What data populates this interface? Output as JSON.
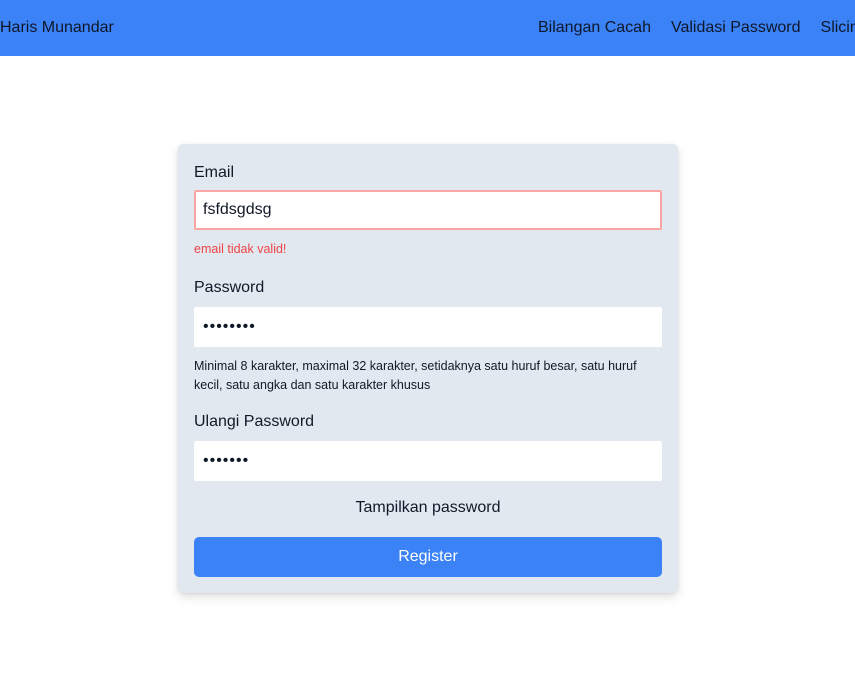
{
  "navbar": {
    "brand": "Haris Munandar",
    "links": [
      "Bilangan Cacah",
      "Validasi Password",
      "Slicing"
    ],
    "background": "#3b82f6"
  },
  "form": {
    "email": {
      "label": "Email",
      "value": "fsfdsgdsg",
      "error": "email tidak valid!"
    },
    "password": {
      "label": "Password",
      "value": "12345678",
      "hint": "Minimal 8 karakter, maximal 32 karakter, setidaknya satu huruf besar, satu huruf kecil, satu angka dan satu karakter khusus"
    },
    "confirm_password": {
      "label": "Ulangi Password",
      "value": "1234567"
    },
    "toggle_label": "Tampilkan password",
    "submit_label": "Register"
  },
  "colors": {
    "accent": "#3b82f6",
    "card_background": "#e2e8f0",
    "error": "#ef4444",
    "invalid_border": "#fca5a5"
  }
}
